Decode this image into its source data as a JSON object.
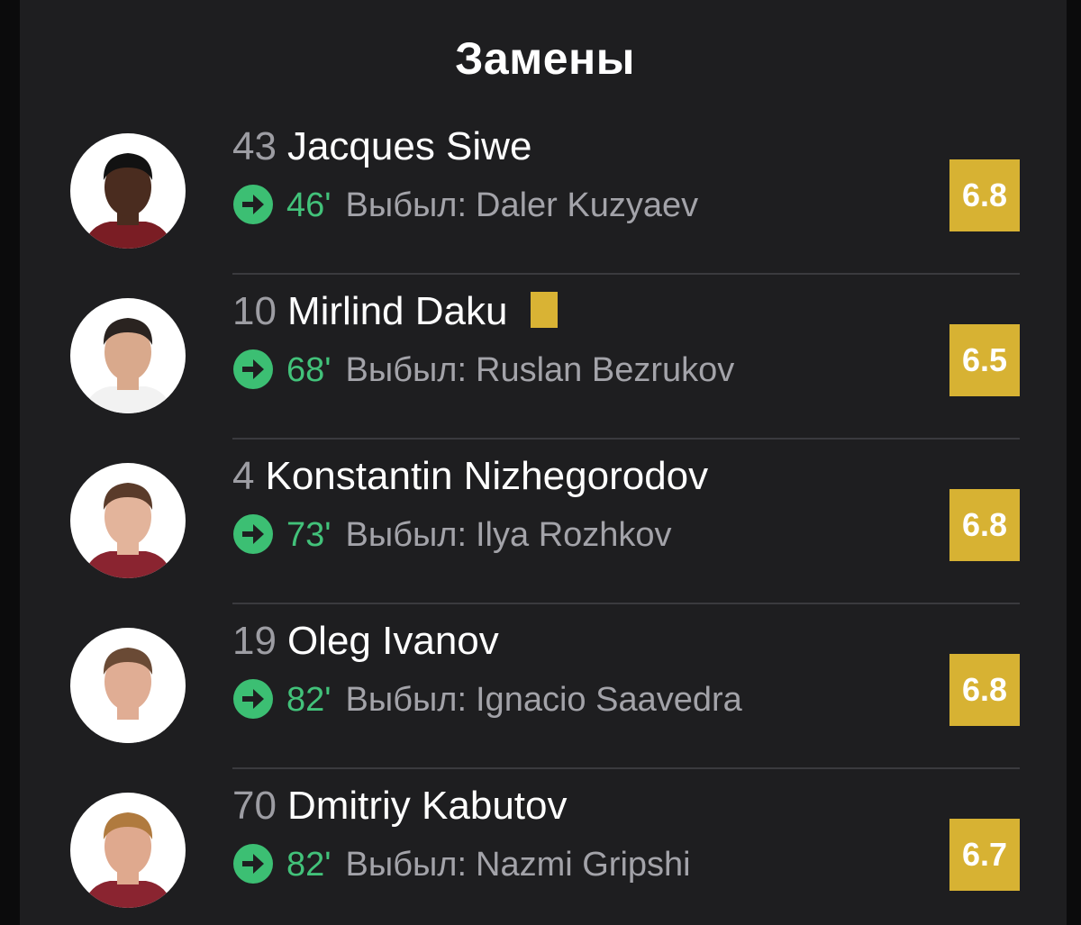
{
  "title": "Замены",
  "colors": {
    "background": "#1e1e20",
    "rating_badge": "#d7b233",
    "minute_green": "#42c27a",
    "yellow_card": "#d9b334"
  },
  "players": [
    {
      "number": "43",
      "name": "Jacques Siwe",
      "minute": "46'",
      "out_label": "Выбыл:",
      "out_player": "Daler Kuzyaev",
      "rating": "6.8",
      "yellow_card": false,
      "skin": "#4a2c1f",
      "hair": "#121212",
      "shirt": "#7a1d24"
    },
    {
      "number": "10",
      "name": "Mirlind Daku",
      "minute": "68'",
      "out_label": "Выбыл:",
      "out_player": "Ruslan Bezrukov",
      "rating": "6.5",
      "yellow_card": true,
      "skin": "#d9a98c",
      "hair": "#2a2320",
      "shirt": "#f2f2f2"
    },
    {
      "number": "4",
      "name": "Konstantin Nizhegorodov",
      "minute": "73'",
      "out_label": "Выбыл:",
      "out_player": "Ilya Rozhkov",
      "rating": "6.8",
      "yellow_card": false,
      "skin": "#e3b49b",
      "hair": "#5a3b2a",
      "shirt": "#8a2430"
    },
    {
      "number": "19",
      "name": "Oleg Ivanov",
      "minute": "82'",
      "out_label": "Выбыл:",
      "out_player": "Ignacio Saavedra",
      "rating": "6.8",
      "yellow_card": false,
      "skin": "#e0ad94",
      "hair": "#6a4a35",
      "shirt": "#ffffff"
    },
    {
      "number": "70",
      "name": "Dmitriy Kabutov",
      "minute": "82'",
      "out_label": "Выбыл:",
      "out_player": "Nazmi Gripshi",
      "rating": "6.7",
      "yellow_card": false,
      "skin": "#dfa98e",
      "hair": "#b07a3e",
      "shirt": "#8a2430"
    }
  ]
}
